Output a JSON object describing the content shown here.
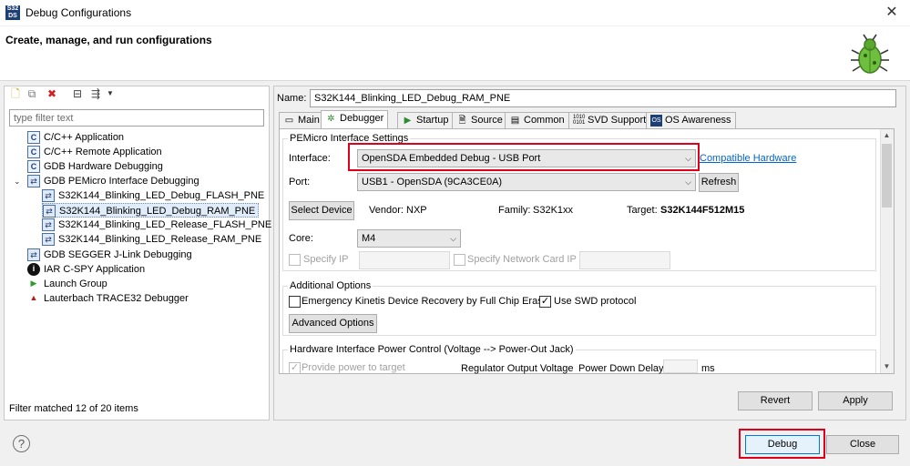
{
  "window": {
    "title": "Debug Configurations",
    "close_glyph": "✕",
    "app_icon_text": "S32\nDS"
  },
  "header": {
    "title": "Create, manage, and run configurations"
  },
  "left": {
    "filter_placeholder": "type filter text",
    "tree": [
      {
        "label": "C/C++ Application",
        "icon": "c-app-icon"
      },
      {
        "label": "C/C++ Remote Application",
        "icon": "c-app-icon"
      },
      {
        "label": "GDB Hardware Debugging",
        "icon": "c-app-icon"
      },
      {
        "label": "GDB PEMicro Interface Debugging",
        "icon": "gdb-icon",
        "expanded": true
      },
      {
        "label": "S32K144_Blinking_LED_Debug_FLASH_PNE",
        "icon": "gdb-icon"
      },
      {
        "label": "S32K144_Blinking_LED_Debug_RAM_PNE",
        "icon": "gdb-icon",
        "selected": true
      },
      {
        "label": "S32K144_Blinking_LED_Release_FLASH_PNE",
        "icon": "gdb-icon"
      },
      {
        "label": "S32K144_Blinking_LED_Release_RAM_PNE",
        "icon": "gdb-icon"
      },
      {
        "label": "GDB SEGGER J-Link Debugging",
        "icon": "c-app-icon"
      },
      {
        "label": "IAR C-SPY Application",
        "icon": "iar-icon"
      },
      {
        "label": "Launch Group",
        "icon": "launch-icon"
      },
      {
        "label": "Lauterbach TRACE32 Debugger",
        "icon": "lauterbach-icon"
      }
    ],
    "status": "Filter matched 12 of 20 items"
  },
  "right": {
    "name_label": "Name:",
    "name_value": "S32K144_Blinking_LED_Debug_RAM_PNE",
    "tabs": [
      {
        "label": "Main",
        "icon": "main-tab-icon"
      },
      {
        "label": "Debugger",
        "icon": "debugger-tab-icon",
        "active": true
      },
      {
        "label": "Startup",
        "icon": "startup-tab-icon"
      },
      {
        "label": "Source",
        "icon": "source-tab-icon"
      },
      {
        "label": "Common",
        "icon": "common-tab-icon"
      },
      {
        "label": "SVD Support",
        "icon": "svd-tab-icon"
      },
      {
        "label": "OS Awareness",
        "icon": "os-tab-icon"
      }
    ],
    "pemicro": {
      "title": "PEMicro Interface Settings",
      "interface_label": "Interface:",
      "interface_value": "OpenSDA Embedded Debug - USB Port",
      "compatible_link": "Compatible Hardware",
      "port_label": "Port:",
      "port_value": "USB1 - OpenSDA (9CA3CE0A)",
      "refresh": "Refresh",
      "select_device": "Select Device",
      "vendor_label": "Vendor:",
      "vendor_value": "NXP",
      "family_label": "Family:",
      "family_value": "S32K1xx",
      "target_label": "Target:",
      "target_value": "S32K144F512M15",
      "core_label": "Core:",
      "core_value": "M4",
      "specify_ip": "Specify IP",
      "specify_nic": "Specify Network Card IP"
    },
    "additional": {
      "title": "Additional Options",
      "emergency": "Emergency Kinetis Device Recovery by Full Chip Erase",
      "emergency_checked": false,
      "swd": "Use SWD protocol",
      "swd_checked": true,
      "advanced": "Advanced Options"
    },
    "power": {
      "title": "Hardware Interface Power Control (Voltage --> Power-Out Jack)",
      "provide": "Provide power to target",
      "regulator": "Regulator Output Voltage",
      "power_down": "Power Down Delay",
      "ms": "ms"
    },
    "revert": "Revert",
    "apply": "Apply"
  },
  "footer": {
    "debug": "Debug",
    "close": "Close",
    "help": "?"
  },
  "colors": {
    "highlight": "#e0001b",
    "link": "#0066cc",
    "selected_bg": "#e0ecf9"
  }
}
